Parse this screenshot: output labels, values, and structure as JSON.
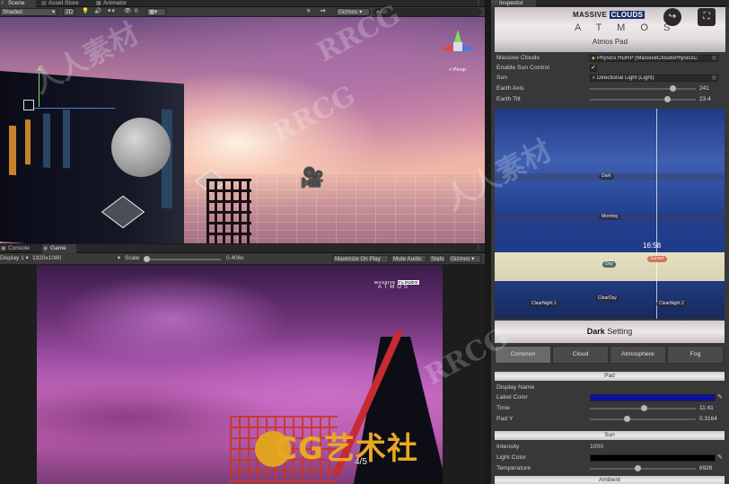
{
  "scene_tabs": [
    "Scene",
    "Asset Store",
    "Animator"
  ],
  "scene_toolbar": {
    "draw_mode": "Shaded",
    "mode_2d": "2D",
    "count_badge": "0",
    "gizmos": "Gizmos",
    "search": "All"
  },
  "scene_gizmo": {
    "persp_label": "< Persp"
  },
  "game_tabs": [
    "Console",
    "Game"
  ],
  "game_toolbar": {
    "display": "Display 1",
    "resolution": "1920x1080",
    "scale_label": "Scale",
    "scale_value": "0.406x",
    "maximize": "Maximize On Play",
    "mute": "Mute Audio",
    "stats": "Stats",
    "gizmos": "Gizmos"
  },
  "game_overlay": {
    "brand_massive": "MASSIVE",
    "brand_clouds": "CLOUDS",
    "brand_atmos": "ATMOS",
    "page_indicator": "4/5",
    "watermark_logo": "CG艺术社"
  },
  "inspector": {
    "tab": "Inspector",
    "header": {
      "brand_massive": "MASSIVE",
      "brand_clouds": "CLOUDS",
      "brand_atmos": "A T M O S",
      "subtitle": "Atmos Pad"
    },
    "properties": [
      {
        "label": "Massive Clouds",
        "value": "Physics HDRP (MassiveCloudsPhysicsC"
      },
      {
        "label": "Enable Sun Control",
        "checked": true
      },
      {
        "label": "Sun",
        "value": "Directional Light (Light)"
      },
      {
        "label": "Earth Axis",
        "value": "241",
        "fraction": 0.75
      },
      {
        "label": "Earth Tilt",
        "value": "23.4",
        "fraction": 0.7
      }
    ],
    "timeline": {
      "time": "16:58",
      "markers": [
        "Dark",
        "Morning",
        "Day",
        "Sunset",
        "ClearNight 1",
        "ClearDay",
        "ClearNight 2"
      ]
    },
    "setting_title_bold": "Dark",
    "setting_title_rest": " Setting",
    "tabs": [
      "Common",
      "Cloud",
      "Atmosphere",
      "Fog"
    ],
    "active_tab": "Common",
    "sections": {
      "pad": {
        "title": "Pad",
        "rows": [
          {
            "label": "Display Name",
            "value": ""
          },
          {
            "label": "Label Color",
            "color": "#0f0fa8"
          },
          {
            "label": "Time",
            "value": "11:41",
            "fraction": 0.48
          },
          {
            "label": "Pad Y",
            "value": "0.3164",
            "fraction": 0.32
          }
        ]
      },
      "sun": {
        "title": "Sun",
        "rows": [
          {
            "label": "Intensity",
            "value": "1000"
          },
          {
            "label": "Light Color",
            "color": "#000000"
          },
          {
            "label": "Temperature",
            "value": "6926",
            "fraction": 0.42
          }
        ]
      },
      "ambient": {
        "title": "Ambient"
      }
    }
  },
  "watermarks": {
    "rrcg": "RRCG",
    "cn": "人人素材"
  },
  "colors": {
    "editor_bg": "#191919",
    "panel_bg": "#383838",
    "label_color": "#0f0fa8",
    "accent_red": "#c62b32"
  }
}
